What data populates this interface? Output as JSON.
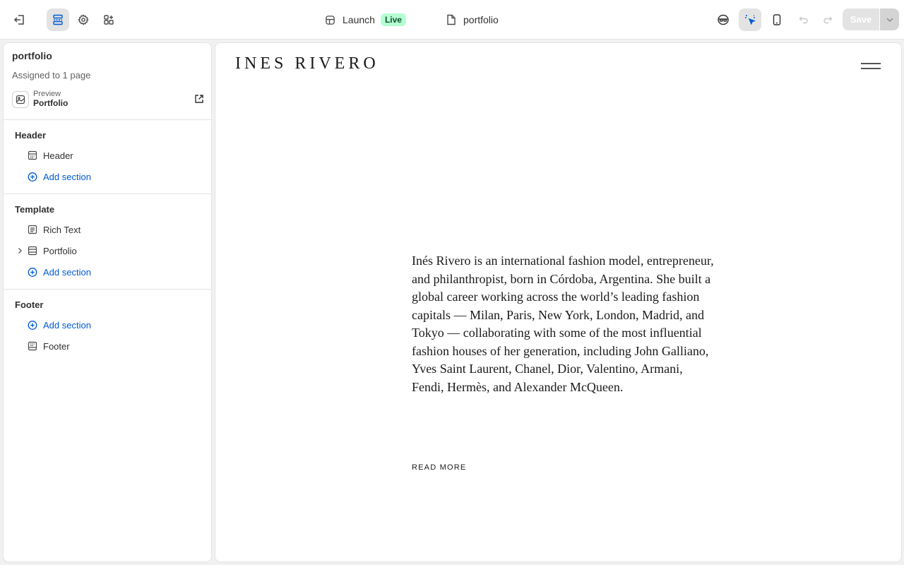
{
  "topbar": {
    "launch_label": "Launch",
    "live_badge": "Live",
    "page_label": "portfolio",
    "save_label": "Save"
  },
  "sidebar": {
    "title": "portfolio",
    "assigned": "Assigned to 1 page",
    "preview_small": "Preview",
    "preview_name": "Portfolio",
    "groups": {
      "header": {
        "label": "Header",
        "items": [
          "Header"
        ],
        "add": "Add section"
      },
      "template": {
        "label": "Template",
        "items": [
          "Rich Text",
          "Portfolio"
        ],
        "add": "Add section"
      },
      "footer": {
        "label": "Footer",
        "add": "Add section",
        "items": [
          "Footer"
        ]
      }
    }
  },
  "canvas": {
    "logo": "INES RIVERO",
    "bio": "Inés Rivero is an international fashion model, entrepreneur, and philanthropist, born in Córdoba, Argentina. She built a global career working across the world’s leading fashion capitals — Milan, Paris, New York, London, Madrid, and Tokyo — collaborating with some of the most influential fashion houses of her generation, including John Galliano, Yves Saint Laurent, Chanel, Dior, Valentino, Armani, Fendi, Hermès, and Alexander McQueen.",
    "read_more": "READ MORE"
  },
  "colors": {
    "accent": "#005bd3",
    "live_bg": "#b4fed2",
    "live_text": "#0c5132"
  },
  "icons": [
    "exit-icon",
    "sections-icon",
    "gear-icon",
    "apps-icon",
    "launch-icon",
    "page-icon",
    "redact-icon",
    "inspector-icon",
    "mobile-icon",
    "undo-icon",
    "redo-icon",
    "chevron-down-icon"
  ]
}
